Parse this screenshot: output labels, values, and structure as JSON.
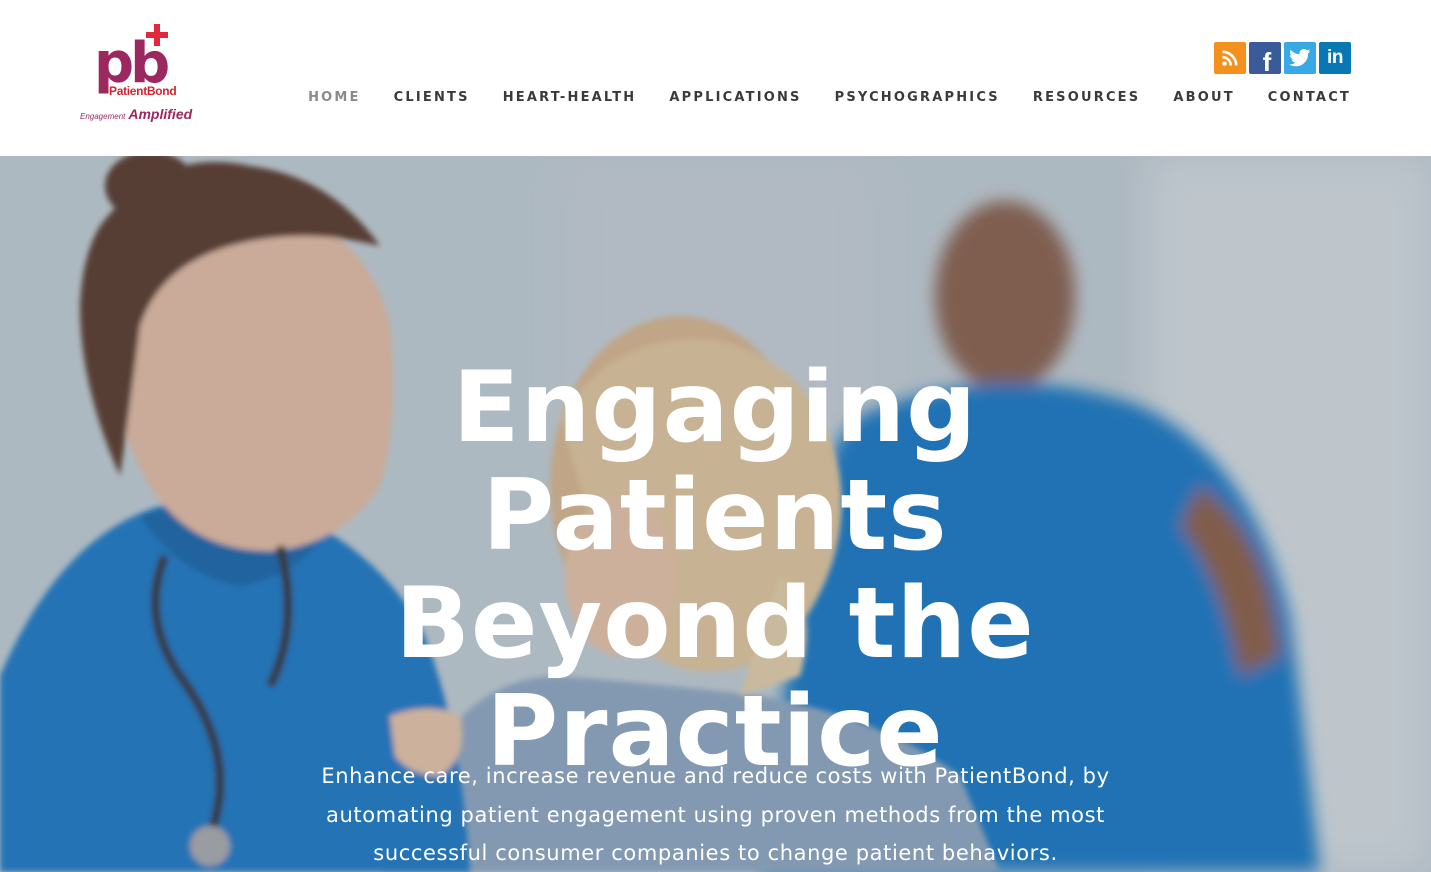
{
  "brand": {
    "mark": "pb",
    "name": "PatientBond",
    "tag_small": "Engagement",
    "tag_big": "Amplified",
    "colors": {
      "primary": "#9c2860",
      "accent": "#e2283b"
    }
  },
  "social": [
    {
      "name": "rss",
      "icon": "rss-icon",
      "color": "#f4901e"
    },
    {
      "name": "facebook",
      "icon": "facebook-icon",
      "glyph": "f",
      "color": "#3b5a9a"
    },
    {
      "name": "twitter",
      "icon": "twitter-icon",
      "color": "#38a9e4"
    },
    {
      "name": "linkedin",
      "icon": "linkedin-icon",
      "glyph": "in",
      "color": "#0a77b5"
    }
  ],
  "nav": [
    {
      "label": "HOME",
      "active": true
    },
    {
      "label": "CLIENTS"
    },
    {
      "label": "HEART-HEALTH"
    },
    {
      "label": "APPLICATIONS"
    },
    {
      "label": "PSYCHOGRAPHICS"
    },
    {
      "label": "RESOURCES"
    },
    {
      "label": "ABOUT"
    },
    {
      "label": "CONTACT"
    }
  ],
  "hero": {
    "title": "Engaging Patients Beyond the Practice",
    "subtitle": "Enhance care, increase revenue and reduce costs with PatientBond, by automating patient engagement using proven methods from the most successful consumer companies to change patient behaviors."
  }
}
